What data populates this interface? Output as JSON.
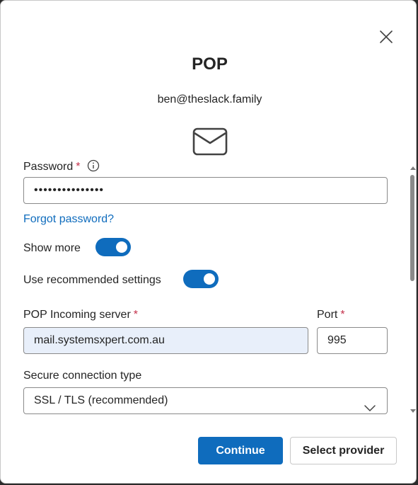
{
  "dialog": {
    "title": "POP",
    "email": "ben@theslack.family"
  },
  "form": {
    "password": {
      "label": "Password",
      "required_mark": "*",
      "value": "•••••••••••••••"
    },
    "forgot_password_link": "Forgot password?",
    "show_more": {
      "label": "Show more",
      "enabled": true
    },
    "use_recommended": {
      "label": "Use recommended settings",
      "enabled": true
    },
    "incoming_server": {
      "label": "POP Incoming server",
      "required_mark": "*",
      "value": "mail.systemsxpert.com.au"
    },
    "port": {
      "label": "Port",
      "required_mark": "*",
      "value": "995"
    },
    "secure_connection": {
      "label": "Secure connection type",
      "selected": "SSL / TLS (recommended)"
    }
  },
  "buttons": {
    "continue": "Continue",
    "select_provider": "Select provider"
  },
  "colors": {
    "accent": "#0f6cbd",
    "required": "#c4314b",
    "active_input_bg": "#e8effa"
  },
  "icons": {
    "close": "close-icon",
    "mail": "mail-icon",
    "info": "info-icon",
    "chevron": "chevron-down-icon"
  }
}
